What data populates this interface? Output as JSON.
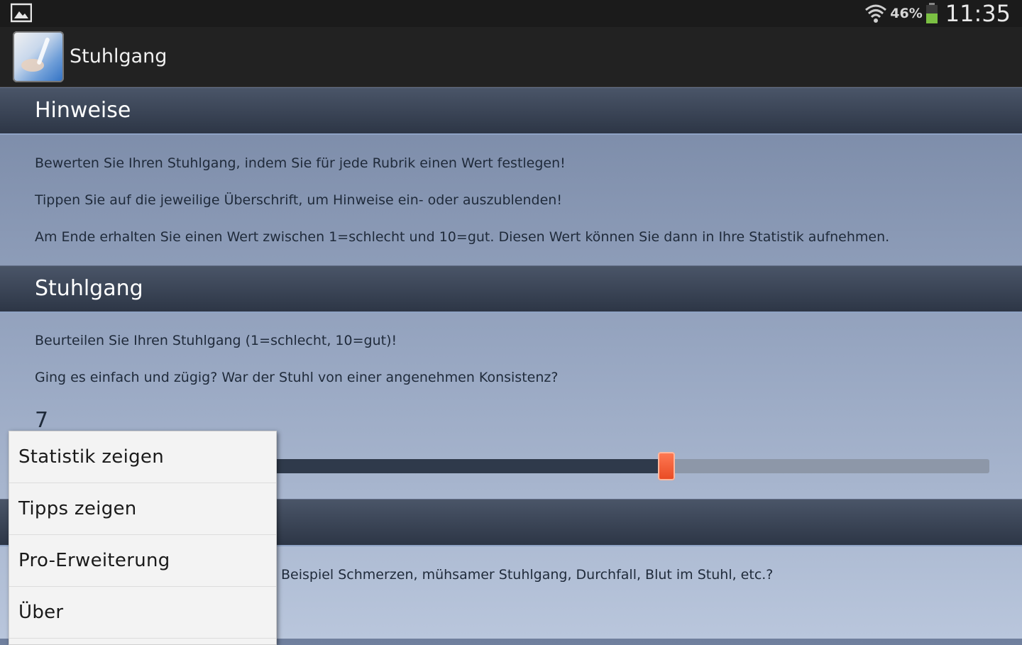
{
  "status_bar": {
    "icons": [
      "image-icon",
      "wifi-icon",
      "battery-icon"
    ],
    "battery_percent": "46%",
    "time": "11:35"
  },
  "action_bar": {
    "title": "Stuhlgang"
  },
  "sections": {
    "hinweise": {
      "title": "Hinweise",
      "lines": [
        "Bewerten Sie Ihren Stuhlgang, indem Sie für jede Rubrik einen Wert festlegen!",
        "Tippen Sie auf die jeweilige Überschrift, um Hinweise ein- oder auszublenden!",
        "Am Ende erhalten Sie einen Wert zwischen 1=schlecht und 10=gut. Diesen Wert können Sie dann in Ihre Statistik aufnehmen."
      ]
    },
    "stuhlgang": {
      "title": "Stuhlgang",
      "lines": [
        "Beurteilen Sie Ihren Stuhlgang (1=schlecht, 10=gut)!",
        "Ging es einfach und zügig? War der Stuhl von einer angenehmen Konsistenz?"
      ],
      "value": "7",
      "slider": {
        "min": 1,
        "max": 10,
        "value": 7
      }
    },
    "third": {
      "partial_line": "Beispiel Schmerzen, mühsamer Stuhlgang, Durchfall, Blut im Stuhl, etc.?"
    }
  },
  "menu": {
    "items": [
      "Statistik zeigen",
      "Tipps zeigen",
      "Pro-Erweiterung",
      "Über"
    ]
  },
  "colors": {
    "accent_thumb": "#e84a22",
    "header_bg": "#2d3646",
    "action_bar_bg": "#222222"
  }
}
